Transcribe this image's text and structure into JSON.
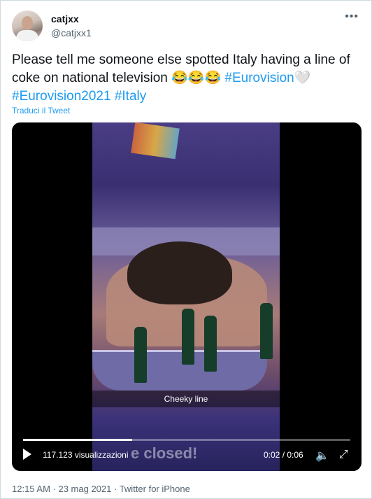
{
  "user": {
    "name": "catjxx",
    "handle": "@catjxx1"
  },
  "tweet": {
    "text_part1": "Please tell me someone else spotted Italy having a line of coke on national television ",
    "emojis": "😂😂😂",
    "hashtag1": "#Eurovision",
    "heart": "🤍",
    "hashtag2": "#Eurovision2021",
    "hashtag3": "#Italy"
  },
  "translate_label": "Traduci il Tweet",
  "more_icon": "more-horizontal-icon",
  "video": {
    "caption": "Cheeky line",
    "overlay_text": "e closed!",
    "views": "117.123 visualizzazioni",
    "time": "0:02 / 0:06",
    "progress": 0.333
  },
  "footer": "12:15 AM · 23 mag 2021 · Twitter for iPhone",
  "colors": {
    "link": "#1d9bf0",
    "secondary": "#536471",
    "video_bg": "#000000"
  }
}
